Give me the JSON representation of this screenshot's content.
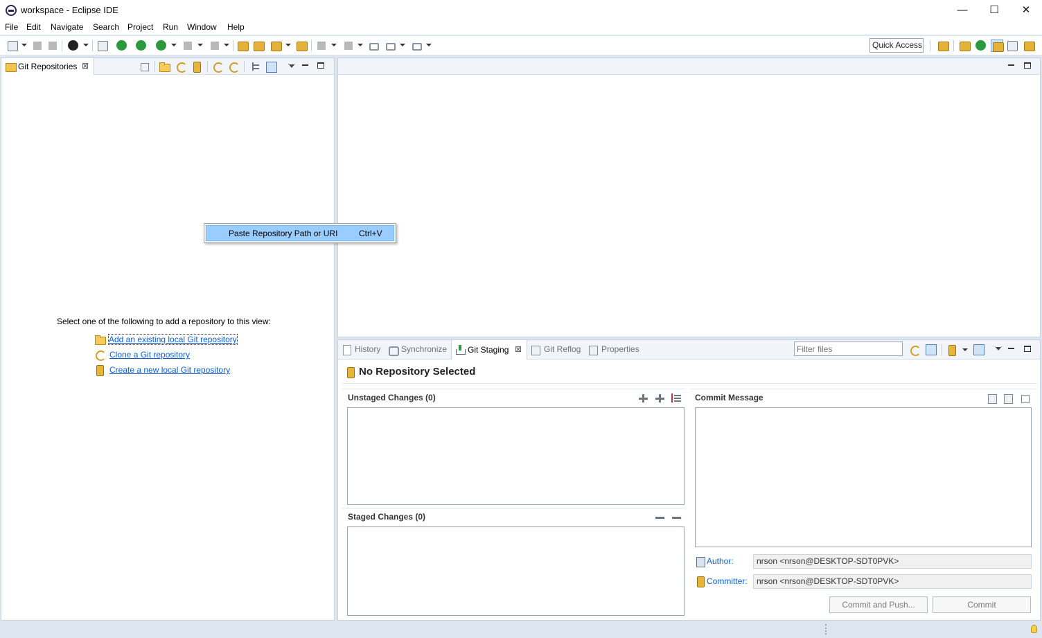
{
  "window": {
    "title": "workspace - Eclipse IDE",
    "minimize": "—",
    "maximize": "☐",
    "close": "✕"
  },
  "menu": [
    "File",
    "Edit",
    "Navigate",
    "Search",
    "Project",
    "Run",
    "Window",
    "Help"
  ],
  "quick_access": "Quick Access",
  "git_repositories": {
    "tab_label": "Git Repositories",
    "intro": "Select one of the following to add a repository to this view:",
    "links": [
      "Add an existing local Git repository",
      "Clone a Git repository",
      "Create a new local Git repository"
    ]
  },
  "context_menu": {
    "item_label": "Paste Repository Path or URI",
    "item_shortcut": "Ctrl+V"
  },
  "bottom_tabs": [
    "History",
    "Synchronize",
    "Git Staging",
    "Git Reflog",
    "Properties"
  ],
  "active_bottom_tab": "Git Staging",
  "filter_placeholder": "Filter files",
  "staging": {
    "repo_title": "No Repository Selected",
    "unstaged_title": "Unstaged Changes (0)",
    "staged_title": "Staged Changes (0)",
    "commit_message_title": "Commit Message",
    "author_label": "Author:",
    "author_value": "nrson <nrson@DESKTOP-SDT0PVK>",
    "committer_label": "Committer:",
    "committer_value": "nrson <nrson@DESKTOP-SDT0PVK>",
    "commit_and_push": "Commit and Push...",
    "commit": "Commit"
  }
}
